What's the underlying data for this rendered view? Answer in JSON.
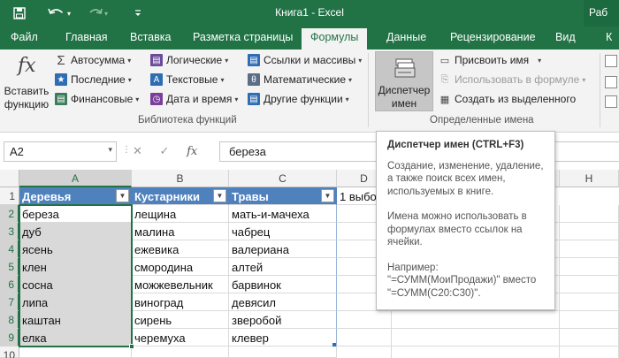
{
  "titlebar": {
    "title": "Книга1 - Excel",
    "right_label": "Раб"
  },
  "tabs": [
    {
      "label": "Файл"
    },
    {
      "label": "Главная"
    },
    {
      "label": "Вставка"
    },
    {
      "label": "Разметка страницы"
    },
    {
      "label": "Формулы",
      "active": true
    },
    {
      "label": "Данные"
    },
    {
      "label": "Рецензирование"
    },
    {
      "label": "Вид"
    },
    {
      "label": "К"
    }
  ],
  "ribbon": {
    "insert_function": {
      "icon": "fx",
      "label_line1": "Вставить",
      "label_line2": "функцию"
    },
    "library": {
      "autosum": "Автосумма",
      "recent": "Последние",
      "financial": "Финансовые",
      "logical": "Логические",
      "text": "Текстовые",
      "datetime": "Дата и время",
      "lookup": "Ссылки и массивы",
      "math": "Математические",
      "other": "Другие функции",
      "group_label": "Библиотека функций"
    },
    "names": {
      "manager_line1": "Диспетчер",
      "manager_line2": "имен",
      "define_name": "Присвоить имя",
      "use_in_formula": "Использовать в формуле",
      "create_from_selection": "Создать из выделенного",
      "group_label": "Определенные имена"
    }
  },
  "formula_bar": {
    "namebox": "A2",
    "cancel_icon": "✕",
    "enter_icon": "✓",
    "fx_icon": "fx",
    "value": "береза"
  },
  "grid": {
    "columns": [
      "A",
      "B",
      "C",
      "D",
      "H"
    ],
    "rows": [
      "1",
      "2",
      "3",
      "4",
      "5",
      "6",
      "7",
      "8",
      "9",
      "10"
    ],
    "headers": [
      "Деревья",
      "Кустарники",
      "Травы"
    ],
    "d1_text": "1 выбо",
    "data": [
      [
        "береза",
        "лещина",
        "мать-и-мачеха"
      ],
      [
        "дуб",
        "малина",
        "чабрец"
      ],
      [
        "ясень",
        "ежевика",
        "валериана"
      ],
      [
        "клен",
        "смородина",
        "алтей"
      ],
      [
        "сосна",
        "можжевельник",
        "барвинок"
      ],
      [
        "липа",
        "виноград",
        "девясил"
      ],
      [
        "каштан",
        "сирень",
        "зверобой"
      ],
      [
        "елка",
        "черемуха",
        "клевер"
      ]
    ]
  },
  "tooltip": {
    "title": "Диспетчер имен (CTRL+F3)",
    "para1": "Создание, изменение, удаление, а также поиск всех имен, используемых в книге.",
    "para2": "Имена можно использовать в формулах вместо ссылок на ячейки.",
    "para3": "Например: \"=СУММ(МоиПродажи)\" вместо \"=СУММ(C20:C30)\"."
  },
  "colors": {
    "excel_green": "#217346",
    "table_header": "#4f81bd",
    "selection": "#d9d9d9"
  }
}
